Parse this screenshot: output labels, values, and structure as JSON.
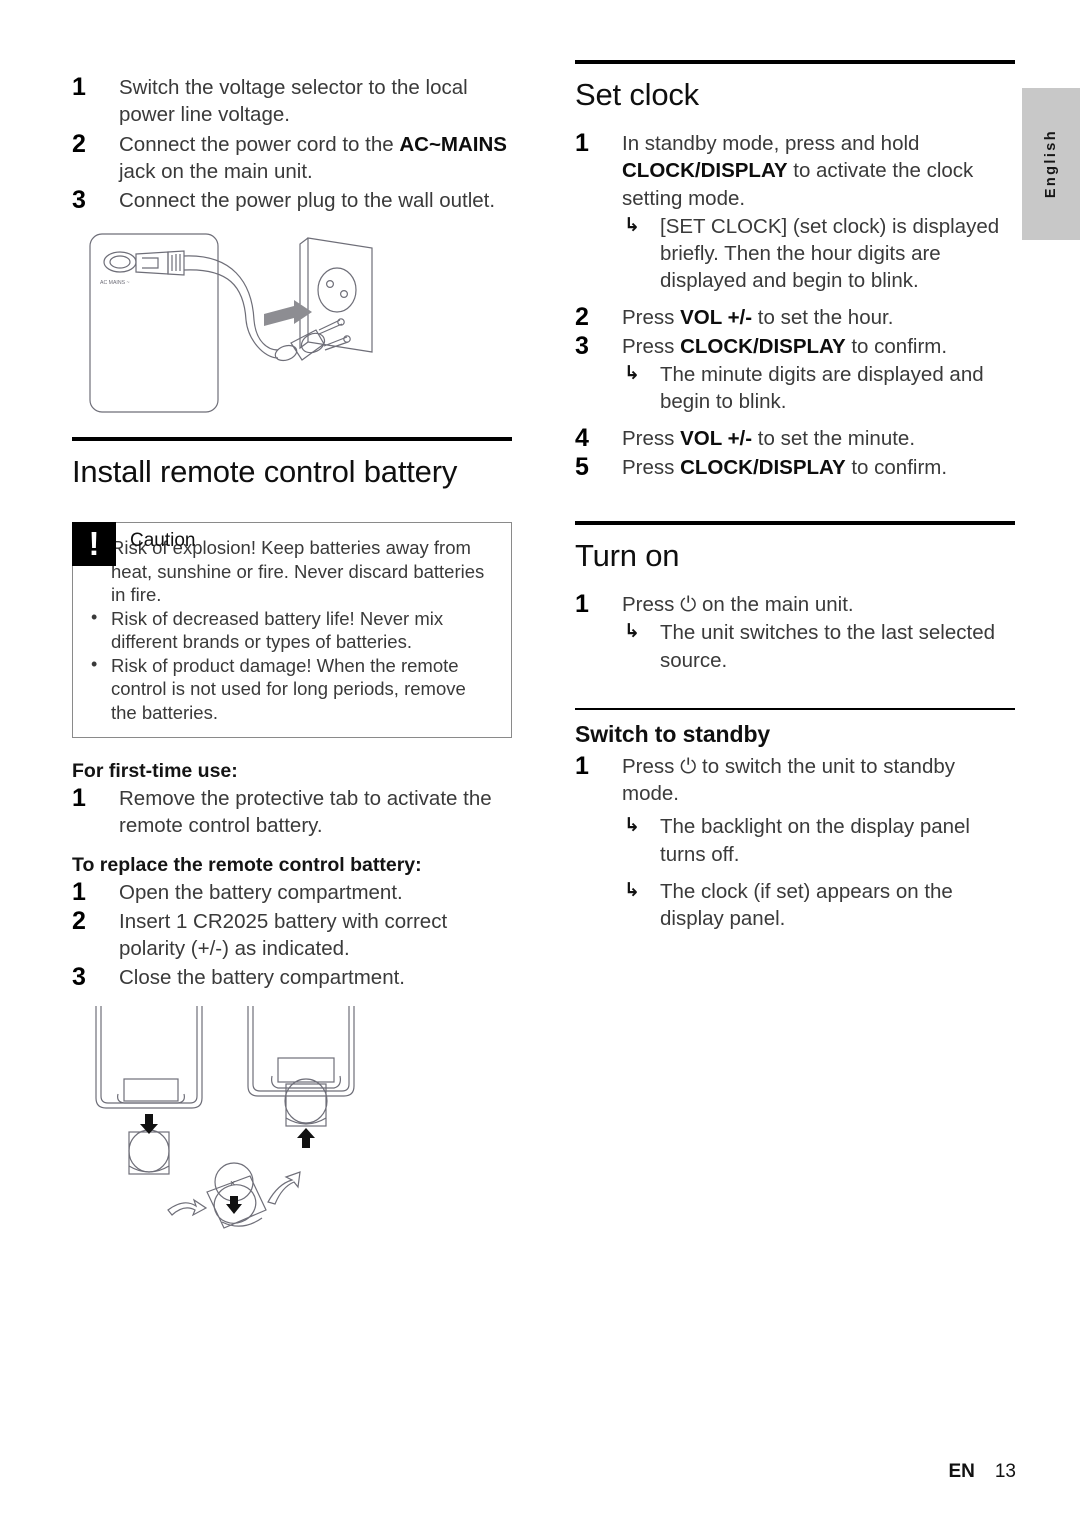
{
  "page": {
    "language_tab": "English",
    "footer_locale": "EN",
    "footer_page_number": "13"
  },
  "left_column": {
    "power_steps": [
      {
        "num": "1",
        "text_before": "Switch the voltage selector to the local power line voltage.",
        "bold": "",
        "text_after": ""
      },
      {
        "num": "2",
        "text_before": "Connect the power cord to the ",
        "bold": "AC~MAINS",
        "text_after": " jack on the main unit."
      },
      {
        "num": "3",
        "text_before": "Connect the power plug to the wall outlet.",
        "bold": "",
        "text_after": ""
      }
    ],
    "power_figure": {
      "caption_on_unit": "AC MAINS ~",
      "alt": "Power cord connecting the main unit AC MAINS jack to a wall outlet"
    },
    "battery_section": {
      "title": "Install remote control battery",
      "caution_label": "Caution",
      "caution_items": [
        "Risk of explosion! Keep batteries away from heat, sunshine or fire. Never discard batteries in fire.",
        "Risk of decreased battery life! Never mix different brands or types of batteries.",
        "Risk of product damage! When the remote control is not used for long periods, remove the batteries."
      ],
      "first_time_heading": "For first-time use:",
      "first_time_steps": [
        {
          "num": "1",
          "text": "Remove the protective tab to activate the remote control battery."
        }
      ],
      "replace_heading": "To replace the remote control battery:",
      "replace_steps": [
        {
          "num": "1",
          "text": "Open the battery compartment."
        },
        {
          "num": "2",
          "text": "Insert 1 CR2025 battery with correct polarity (+/-) as indicated."
        },
        {
          "num": "3",
          "text": "Close the battery compartment."
        }
      ],
      "battery_figure": {
        "alt": "Remote control battery compartment: insert and remove CR2025 coin cell"
      }
    }
  },
  "right_column": {
    "set_clock": {
      "title": "Set clock",
      "steps": [
        {
          "num": "1",
          "parts": [
            {
              "t": "In standby mode, press and hold "
            },
            {
              "t": "CLOCK/DISPLAY",
              "b": true
            },
            {
              "t": " to activate the clock setting mode."
            }
          ],
          "results": [
            "[SET CLOCK] (set clock) is displayed briefly. Then the hour digits are displayed and begin to blink."
          ]
        },
        {
          "num": "2",
          "parts": [
            {
              "t": "Press "
            },
            {
              "t": "VOL +/-",
              "b": true
            },
            {
              "t": " to set the hour."
            }
          ],
          "results": []
        },
        {
          "num": "3",
          "parts": [
            {
              "t": "Press "
            },
            {
              "t": "CLOCK/DISPLAY",
              "b": true
            },
            {
              "t": " to confirm."
            }
          ],
          "results": [
            "The minute digits are displayed and begin to blink."
          ]
        },
        {
          "num": "4",
          "parts": [
            {
              "t": "Press "
            },
            {
              "t": "VOL +/-",
              "b": true
            },
            {
              "t": " to set the minute."
            }
          ],
          "results": []
        },
        {
          "num": "5",
          "parts": [
            {
              "t": "Press "
            },
            {
              "t": "CLOCK/DISPLAY",
              "b": true
            },
            {
              "t": " to confirm."
            }
          ],
          "results": []
        }
      ]
    },
    "turn_on": {
      "title": "Turn on",
      "steps": [
        {
          "num": "1",
          "parts": [
            {
              "t": "Press "
            },
            {
              "t": "⏻",
              "sym": true
            },
            {
              "t": " on the main unit."
            }
          ],
          "results": [
            "The unit switches to the last selected source."
          ]
        }
      ]
    },
    "switch_to_standby": {
      "title": "Switch to standby",
      "steps": [
        {
          "num": "1",
          "parts": [
            {
              "t": "Press "
            },
            {
              "t": "⏻",
              "sym": true
            },
            {
              "t": " to switch the unit to standby mode."
            }
          ],
          "results": [
            "The backlight on the display panel turns off.",
            "The clock (if set) appears on the display panel."
          ]
        }
      ]
    }
  },
  "icons": {
    "result_arrow": "↳",
    "bullet": "•",
    "power_symbol": "⏻",
    "caution_bang": "!"
  }
}
